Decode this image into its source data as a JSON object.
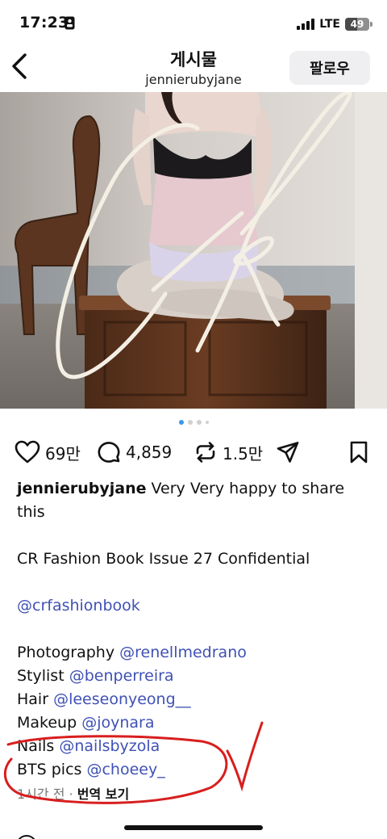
{
  "status_bar": {
    "time": "17:23",
    "network": "LTE",
    "battery": "49",
    "battery_level_pct": 49
  },
  "header": {
    "title": "게시물",
    "username": "jennierubyjane",
    "follow_label": "팔로우"
  },
  "post": {
    "image_alt": "jennierubyjane 게시물 사진",
    "carousel": {
      "total": 4,
      "active_index": 0
    },
    "actions": {
      "likes": "69만",
      "comments": "4,859",
      "reposts": "1.5만"
    }
  },
  "caption": {
    "username": "jennierubyjane",
    "intro": "Very Very happy to share this",
    "headline": "CR Fashion Book Issue 27 Confidential",
    "tag": "@crfashionbook",
    "credits": [
      {
        "role": "Photography",
        "handle": "@renellmedrano"
      },
      {
        "role": "Stylist",
        "handle": "@benperreira"
      },
      {
        "role": "Hair",
        "handle": "@leeseonyeong__"
      },
      {
        "role": "Makeup",
        "handle": "@joynara"
      },
      {
        "role": "Nails",
        "handle": "@nailsbyzola"
      },
      {
        "role": "BTS pics",
        "handle": "@choeey_"
      }
    ],
    "time_ago": "1시간 전",
    "separator": "·",
    "translate": "번역 보기"
  },
  "colors": {
    "accent_blue": "#3797f0",
    "mention": "#3f51b5",
    "annotation_red": "#d81e1e"
  }
}
